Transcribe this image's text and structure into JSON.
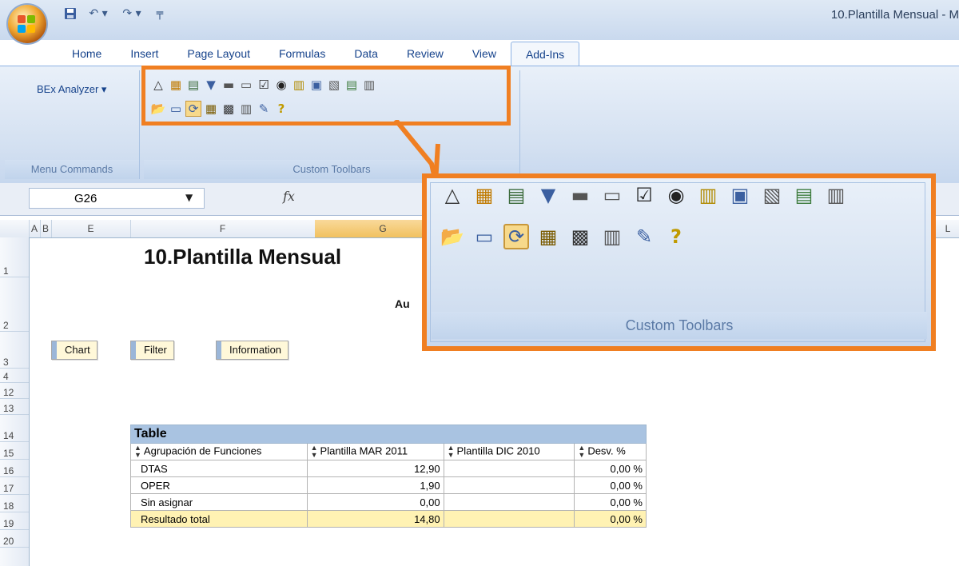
{
  "window": {
    "title": "10.Plantilla Mensual - M"
  },
  "quick_access": {
    "icons": [
      "save-icon",
      "undo-icon",
      "redo-icon",
      "customize-icon"
    ],
    "undo_glyph": "↶ ▾",
    "redo_glyph": "↷ ▾",
    "customize_glyph": "╤"
  },
  "tabs": [
    {
      "label": "Home"
    },
    {
      "label": "Insert"
    },
    {
      "label": "Page Layout"
    },
    {
      "label": "Formulas"
    },
    {
      "label": "Data"
    },
    {
      "label": "Review"
    },
    {
      "label": "View"
    },
    {
      "label": "Add-Ins",
      "active": true
    }
  ],
  "ribbon": {
    "bex_analyzer": "BEx Analyzer ▾",
    "group_menu_commands": "Menu Commands",
    "group_custom_toolbars": "Custom Toolbars",
    "toolbar_row1": [
      "△",
      "▦",
      "▤",
      "▼",
      "▬",
      "▭",
      "☑",
      "◉",
      "▥",
      "▣",
      "▧",
      "▤",
      "▥"
    ],
    "toolbar_row2": [
      "📂",
      "▭",
      "⟳",
      "▦",
      "▩",
      "▥",
      "✎",
      "?"
    ],
    "selected_row2_index": 2
  },
  "formula_bar": {
    "cell_ref": "G26",
    "fx": "fx"
  },
  "columns": [
    {
      "label": "A"
    },
    {
      "label": "B"
    },
    {
      "label": "E"
    },
    {
      "label": "F"
    },
    {
      "label": "G",
      "selected": true
    },
    {
      "label": "L"
    }
  ],
  "rows": [
    "1",
    "2",
    "3",
    "4",
    "12",
    "13",
    "14",
    "15",
    "16",
    "17",
    "18",
    "19",
    "20"
  ],
  "sheet": {
    "title": "10.Plantilla Mensual",
    "subtitle_fragment": "Au",
    "buttons": [
      "Chart",
      "Filter",
      "Information"
    ]
  },
  "table": {
    "caption": "Table",
    "headers": [
      "Agrupación de Funciones",
      "Plantilla MAR 2011",
      "Plantilla DIC 2010",
      "Desv. %"
    ],
    "rows": [
      {
        "label": "DTAS",
        "mar": "12,90",
        "dic": "",
        "desv": "0,00 %"
      },
      {
        "label": "OPER",
        "mar": "1,90",
        "dic": "",
        "desv": "0,00 %"
      },
      {
        "label": "Sin asignar",
        "mar": "0,00",
        "dic": "",
        "desv": "0,00 %"
      },
      {
        "label": "Resultado total",
        "mar": "14,80",
        "dic": "",
        "desv": "0,00 %"
      }
    ]
  },
  "callout": {
    "label": "Custom Toolbars"
  },
  "colors": {
    "accent_orange": "#f07f22",
    "ribbon_blue": "#15428b",
    "total_row": "#fff2b3",
    "table_caption": "#a9c3e1"
  }
}
